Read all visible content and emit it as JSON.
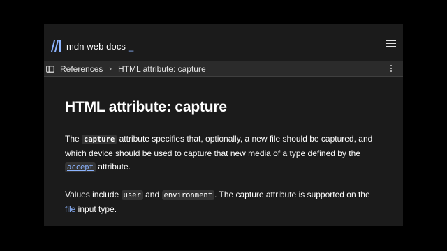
{
  "header": {
    "logo_text": "mdn web docs",
    "logo_cursor": "_",
    "menu_icon": "hamburger-menu-icon"
  },
  "breadcrumb": {
    "sidebar_icon": "sidebar-toggle-icon",
    "items": [
      "References",
      "HTML attribute: capture"
    ],
    "separator": "›",
    "more_icon": "kebab-menu-icon"
  },
  "article": {
    "title": "HTML attribute: capture",
    "p1": {
      "t1": "The ",
      "code1": "capture",
      "t2": " attribute specifies that, optionally, a new file should be captured, and which device should be used to capture that new media of a type defined by the ",
      "link1": "accept",
      "t3": " attribute."
    },
    "p2": {
      "t1": "Values include ",
      "code1": "user",
      "t2": " and ",
      "code2": "environment",
      "t3": ". The capture attribute is supported on the ",
      "link1": "file",
      "t4": " input type."
    }
  },
  "colors": {
    "background": "#1b1b1b",
    "link": "#8cb4ff",
    "text": "#ffffff",
    "crumb_bar": "#2b2b2b"
  }
}
